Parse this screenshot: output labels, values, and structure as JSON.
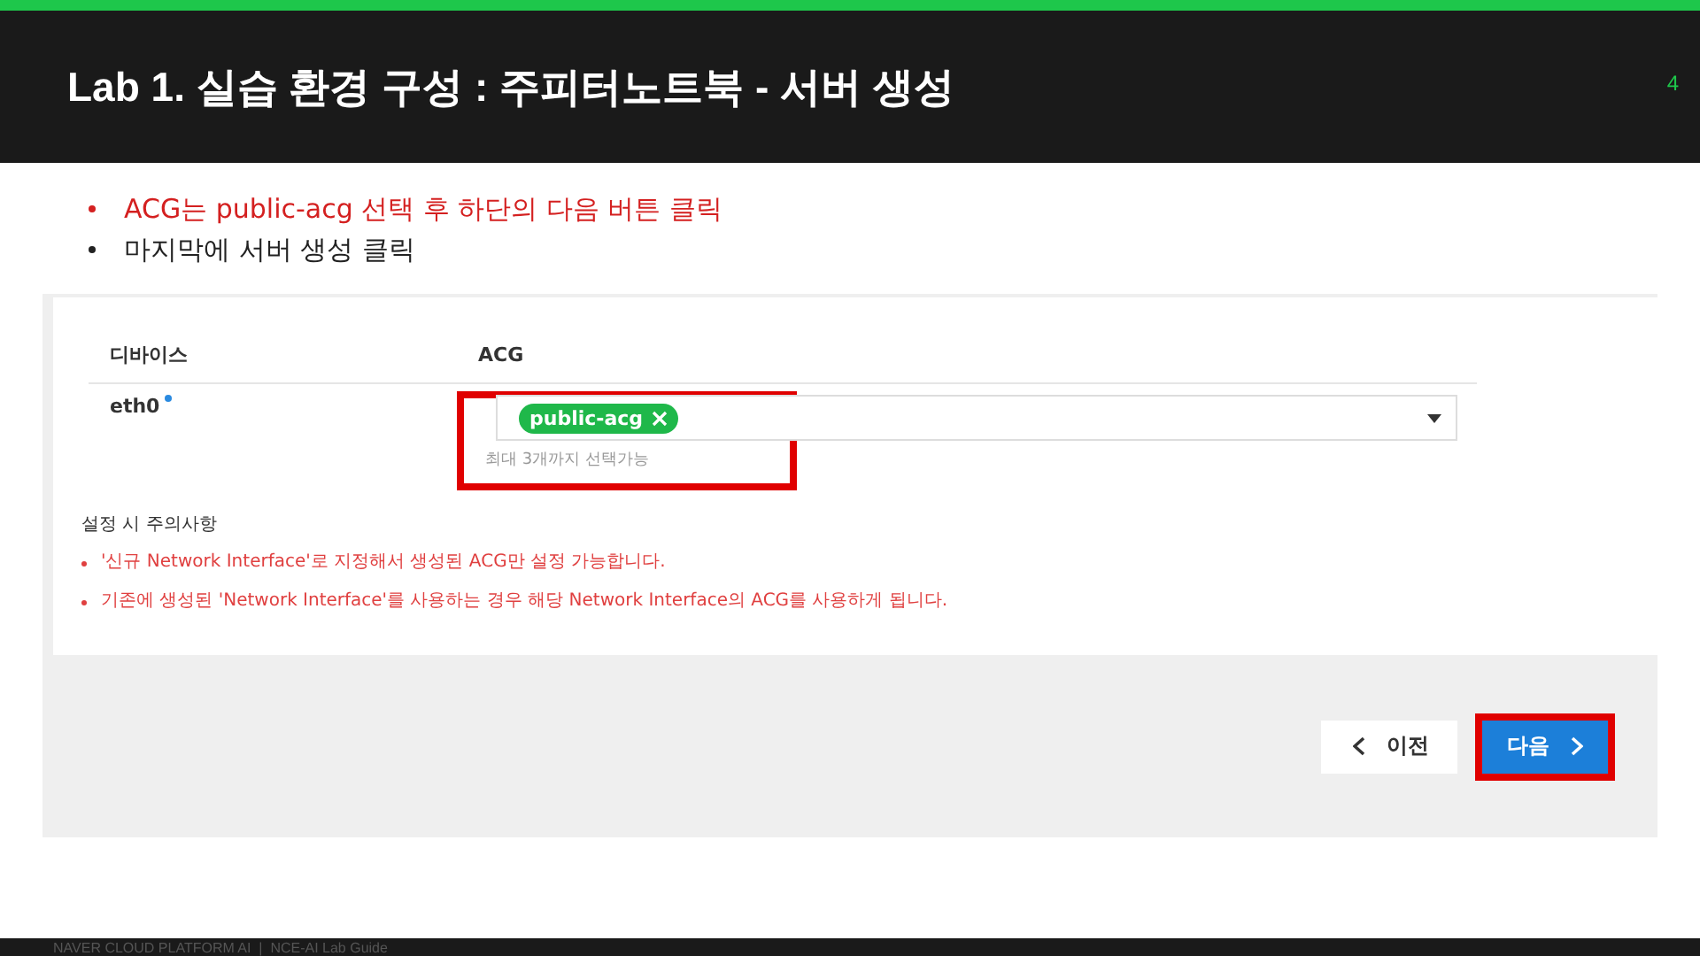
{
  "slide": {
    "title": "Lab 1. 실습 환경 구성 : 주피터노트북 - 서버 생성",
    "page_number": "4"
  },
  "bullets": [
    {
      "text": "ACG는 public-acg 선택 후 하단의 다음 버튼 클릭",
      "color": "#d42020"
    },
    {
      "text": "마지막에 서버 생성 클릭",
      "color": "#222222"
    }
  ],
  "screen": {
    "table": {
      "columns": [
        "디바이스",
        "ACG"
      ],
      "rows": [
        {
          "device": "eth0",
          "required": true,
          "tags": [
            "public-acg"
          ],
          "hint": "최대 3개까지 선택가능",
          "highlighted": true
        }
      ]
    },
    "notes_title": "설정 시 주의사항",
    "notes": [
      "'신규 Network Interface'로 지정해서 생성된 ACG만 설정 가능합니다.",
      "기존에 생성된 'Network Interface'를 사용하는 경우 해당 Network Interface의 ACG를 사용하게 됩니다."
    ],
    "buttons": [
      {
        "label": "이전",
        "kind": "prev",
        "highlighted": false
      },
      {
        "label": "다음",
        "kind": "next",
        "highlighted": true
      }
    ]
  },
  "footer": "NAVER CLOUD PLATFORM AI  |  NCE-AI Lab Guide"
}
